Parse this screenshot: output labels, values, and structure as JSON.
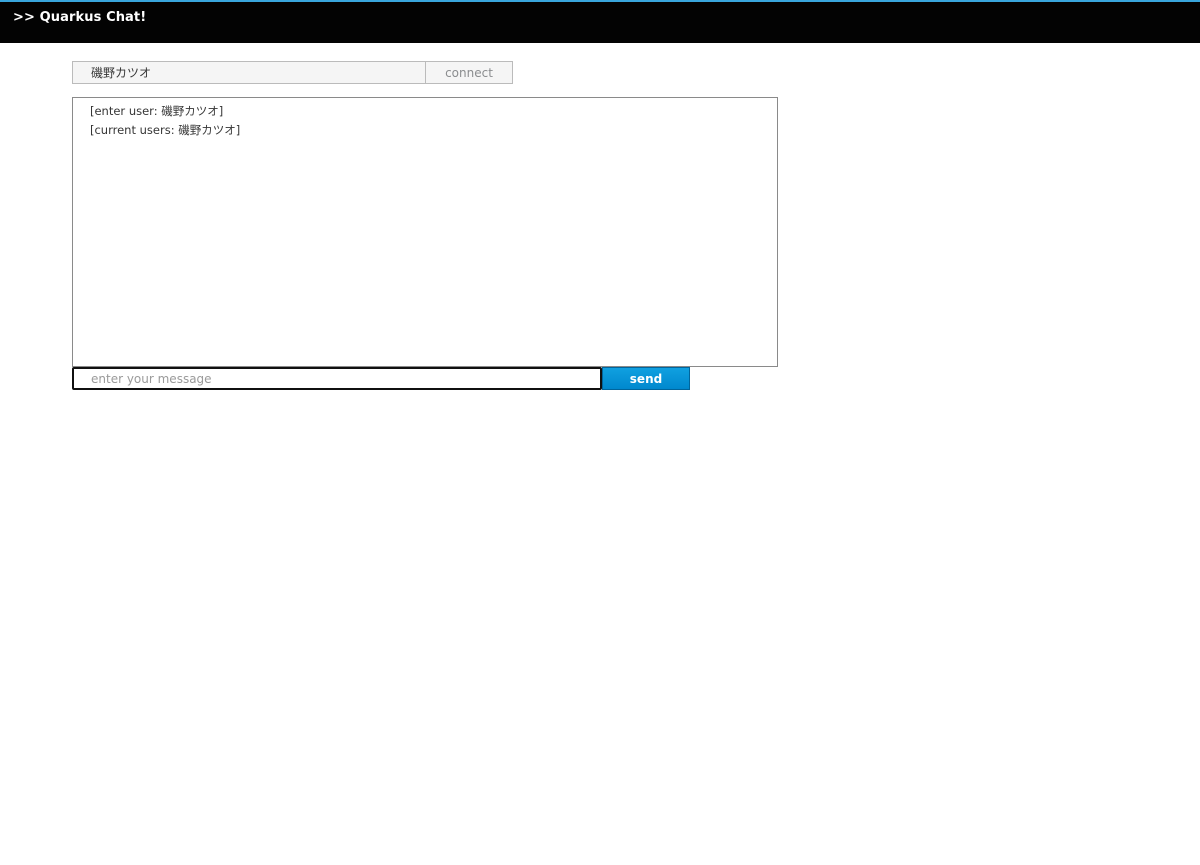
{
  "header": {
    "brand": ">> Quarkus Chat!"
  },
  "connect_form": {
    "name_value": "磯野カツオ",
    "connect_label": "connect"
  },
  "chat_log": {
    "lines": [
      "[enter user: 磯野カツオ]",
      "[current users: 磯野カツオ]"
    ]
  },
  "message_form": {
    "message_value": "",
    "message_placeholder": "enter your message",
    "send_label": "send"
  },
  "colors": {
    "header_background": "#030303",
    "header_accent": "#39a5dc",
    "send_button": "#0088ce"
  }
}
